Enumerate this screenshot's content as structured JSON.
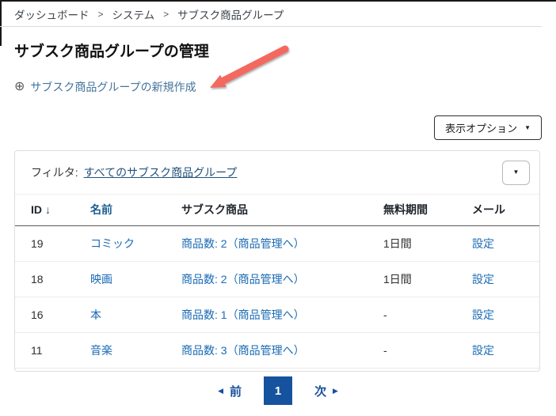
{
  "breadcrumb": {
    "separator": ">",
    "items": [
      "ダッシュボード",
      "システム",
      "サブスク商品グループ"
    ]
  },
  "page": {
    "title": "サブスク商品グループの管理"
  },
  "create_link": {
    "label": "サブスク商品グループの新規作成"
  },
  "toolbar": {
    "display_options_label": "表示オプション"
  },
  "filter": {
    "label": "フィルタ:",
    "value": "すべてのサブスク商品グループ"
  },
  "table": {
    "headers": [
      "ID",
      "名前",
      "サブスク商品",
      "無料期間",
      "メール"
    ],
    "rows": [
      {
        "id": "19",
        "name": "コミック",
        "products": "商品数: 2（商品管理へ）",
        "free_period": "1日間",
        "mail": "設定"
      },
      {
        "id": "18",
        "name": "映画",
        "products": "商品数: 2（商品管理へ）",
        "free_period": "1日間",
        "mail": "設定"
      },
      {
        "id": "16",
        "name": "本",
        "products": "商品数: 1（商品管理へ）",
        "free_period": "-",
        "mail": "設定"
      },
      {
        "id": "11",
        "name": "音楽",
        "products": "商品数: 3（商品管理へ）",
        "free_period": "-",
        "mail": "設定"
      }
    ]
  },
  "pagination": {
    "prev_label": "前",
    "current_page": "1",
    "next_label": "次"
  },
  "icons": {
    "circle_plus": "⊕",
    "caret_down": "▼",
    "sort_desc": "↓",
    "prev_arrow": "◀",
    "next_arrow": "▶"
  },
  "colors": {
    "annotation_arrow": "#f4695f",
    "table_link": "#1a6bb5",
    "dark_link": "#23527c",
    "pagination_blue": "#164f9c",
    "current_page_bg": "#15539e"
  }
}
